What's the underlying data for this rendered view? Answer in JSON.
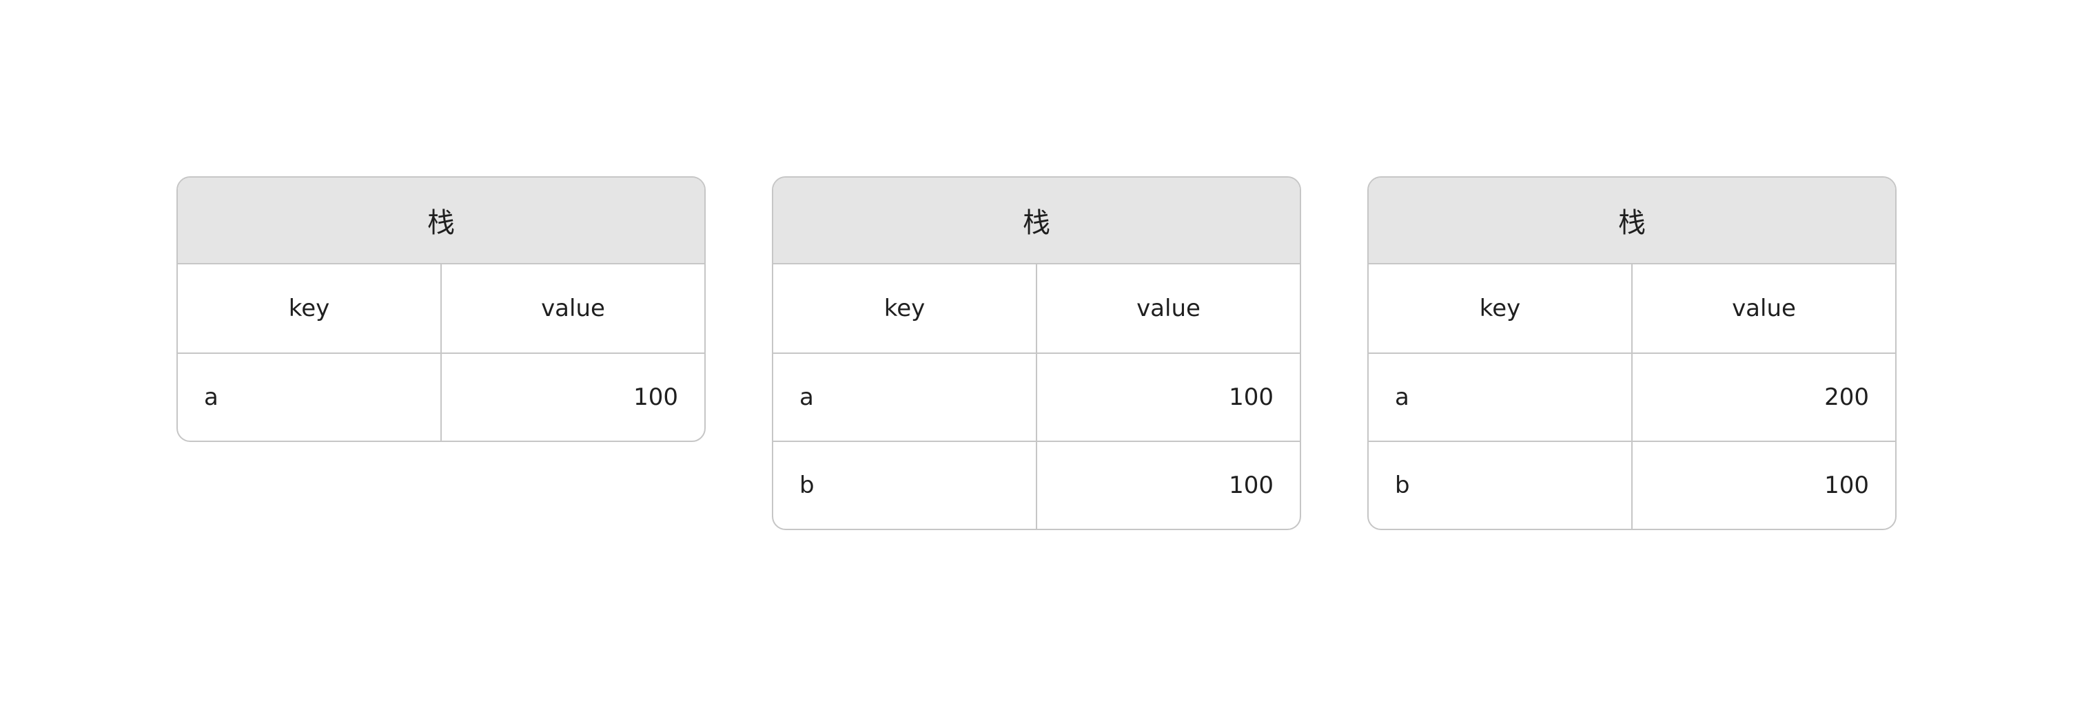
{
  "tables": [
    {
      "title": "栈",
      "columns": [
        "key",
        "value"
      ],
      "rows": [
        {
          "key": "a",
          "value": "100"
        }
      ]
    },
    {
      "title": "栈",
      "columns": [
        "key",
        "value"
      ],
      "rows": [
        {
          "key": "a",
          "value": "100"
        },
        {
          "key": "b",
          "value": "100"
        }
      ]
    },
    {
      "title": "栈",
      "columns": [
        "key",
        "value"
      ],
      "rows": [
        {
          "key": "a",
          "value": "200"
        },
        {
          "key": "b",
          "value": "100"
        }
      ]
    }
  ]
}
